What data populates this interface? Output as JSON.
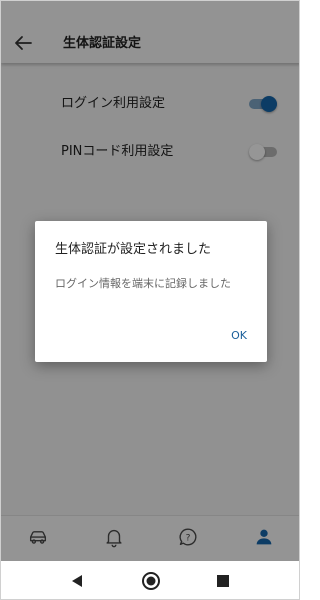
{
  "header": {
    "back_icon": "arrow-left-icon",
    "title": "生体認証設定"
  },
  "settings": [
    {
      "label": "ログイン利用設定",
      "enabled": true
    },
    {
      "label": "PINコード利用設定",
      "enabled": false
    }
  ],
  "bottom_nav": {
    "items": [
      {
        "icon": "car-icon",
        "active": false
      },
      {
        "icon": "bell-icon",
        "active": false
      },
      {
        "icon": "help-icon",
        "active": false
      },
      {
        "icon": "person-icon",
        "active": true
      }
    ]
  },
  "system_nav": {
    "items": [
      "back-triangle-icon",
      "home-circle-icon",
      "recents-square-icon"
    ]
  },
  "dialog": {
    "title": "生体認証が設定されました",
    "message": "ログイン情報を端末に記録しました",
    "ok_label": "OK"
  },
  "colors": {
    "accent": "#1565a8",
    "toggle_on_track": "#7ea3c4",
    "toggle_off_track": "#b4b4b4",
    "scrim": "rgba(0,0,0,0.40)",
    "dialog_button": "#1a5f9a"
  }
}
